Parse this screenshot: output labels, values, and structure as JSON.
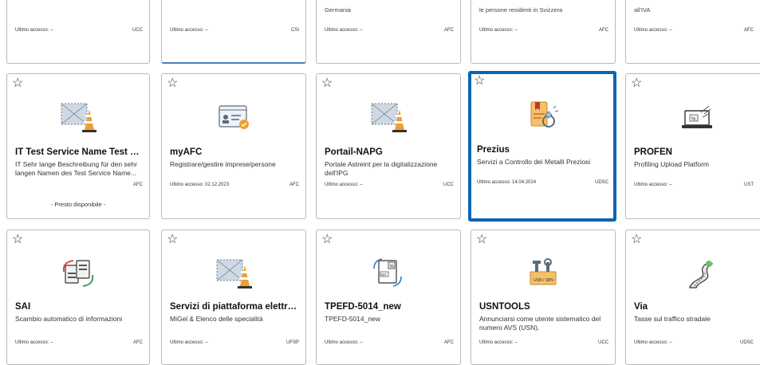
{
  "row0": [
    {
      "desc": "",
      "access": "Ultimo accesso: --",
      "org": "UCC"
    },
    {
      "desc": "",
      "access": "Ultimo accesso: --",
      "org": "CSI"
    },
    {
      "desc": "Germania",
      "access": "Ultimo accesso: --",
      "org": "AFC"
    },
    {
      "desc": "le persone residenti in Svizzera",
      "access": "Ultimo accesso: --",
      "org": "AFC"
    },
    {
      "desc": "all'IVA",
      "access": "Ultimo accesso: --",
      "org": "AFC"
    }
  ],
  "row1": [
    {
      "title": "IT Test Service Name Test S...",
      "desc": "IT Sehr lange Beschreibung für den sehr langen Namen des Test Service Name...",
      "access": "",
      "org": "AFC",
      "soon": "- Presto disponibile -",
      "icon": "placeholder-icon"
    },
    {
      "title": "myAFC",
      "desc": "Registrare/gestire imprese/persone",
      "access": "Ultimo accesso: 02.12.2023",
      "org": "AFC",
      "icon": "business-card-icon"
    },
    {
      "title": "Portail-NAPG",
      "desc": "Portale Astreint per la digitalizzazione dell'IPG",
      "access": "Ultimo accesso: --",
      "org": "UCC",
      "icon": "placeholder-icon"
    },
    {
      "title": "Prezius",
      "desc": "Servizi a Controllo dei Metalli Preziosi",
      "access": "Ultimo accesso: 14.04.2024",
      "org": "UDSC",
      "icon": "precious-metal-icon"
    },
    {
      "title": "PROFEN",
      "desc": "Profiling Upload Platform",
      "access": "Ultimo accesso: --",
      "org": "UST",
      "icon": "laptop-upload-icon"
    }
  ],
  "row2": [
    {
      "title": "SAI",
      "desc": "Scambio automatico di informazioni",
      "access": "Ultimo accesso: --",
      "org": "AFC",
      "icon": "document-exchange-icon"
    },
    {
      "title": "Servizi di piattaforma elettro...",
      "desc": "MiGel & Elenco delle specialità",
      "access": "Ultimo accesso: --",
      "org": "UFSP",
      "icon": "placeholder-icon"
    },
    {
      "title": "TPEFD-5014_new",
      "desc": "TPEFD-5014_new",
      "access": "Ultimo accesso: --",
      "org": "AFC",
      "icon": "vat-document-icon"
    },
    {
      "title": "USNTOOLS",
      "desc": "Annunciarsi come utente sistematico del numero AVS (USN).",
      "access": "Ultimo accesso: --",
      "org": "UCC",
      "icon": "toolbox-icon",
      "badge": "USN / SBN"
    },
    {
      "title": "Via",
      "desc": "Tasse sul traffico stradale",
      "access": "Ultimo accesso: --",
      "org": "UDSC",
      "icon": "road-icon"
    }
  ],
  "star_glyph": "☆",
  "colors": {
    "selected_border": "#0b63b5",
    "accent_orange": "#f0a030"
  }
}
